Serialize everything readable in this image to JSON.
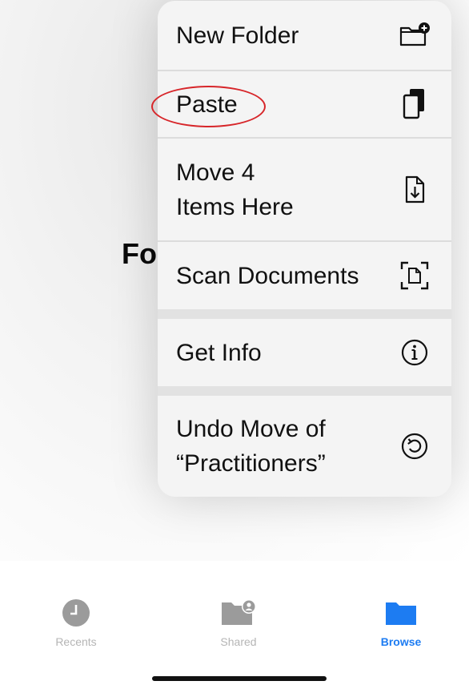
{
  "background": {
    "title": "Fo"
  },
  "menu": {
    "items": [
      {
        "label": "New Folder",
        "icon": "new-folder-icon"
      },
      {
        "label": "Paste",
        "icon": "paste-icon"
      },
      {
        "label_line1": "Move 4",
        "label_line2": "Items Here",
        "icon": "move-document-icon"
      },
      {
        "label": "Scan Documents",
        "icon": "scan-document-icon"
      },
      {
        "label": "Get Info",
        "icon": "info-icon"
      },
      {
        "label_line1": "Undo Move of",
        "label_line2": "“Practitioners”",
        "icon": "undo-icon"
      }
    ],
    "highlight_color": "#d7262a"
  },
  "tabbar": {
    "recents": {
      "label": "Recents",
      "icon": "clock-icon"
    },
    "shared": {
      "label": "Shared",
      "icon": "shared-folder-icon"
    },
    "browse": {
      "label": "Browse",
      "icon": "folder-icon"
    },
    "active_color": "#1d7cf2",
    "inactive_color": "#b5b5b5"
  }
}
